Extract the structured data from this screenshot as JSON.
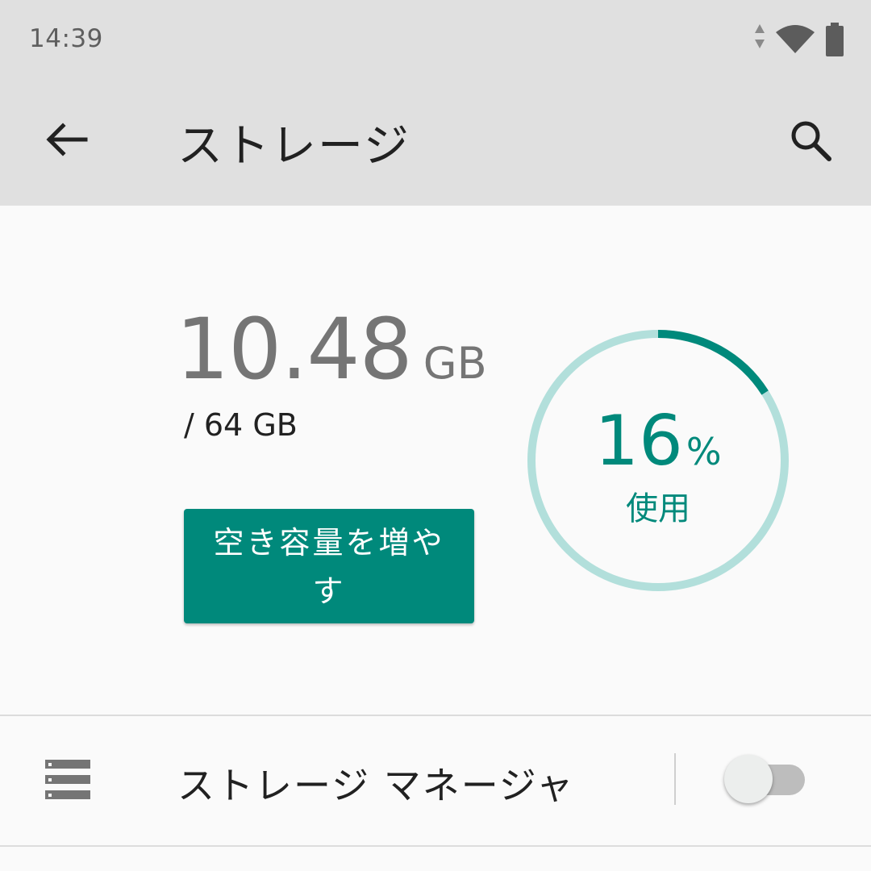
{
  "status_bar": {
    "time": "14:39",
    "icons": [
      "data-arrows-icon",
      "wifi-icon",
      "battery-icon"
    ]
  },
  "app_bar": {
    "title": "ストレージ",
    "back_icon": "arrow-back-icon",
    "search_icon": "search-icon"
  },
  "storage": {
    "used_value": "10.48",
    "used_unit": "GB",
    "total": "/ 64 GB",
    "free_up_button": "空き容量を増やす",
    "percent_value": "16",
    "percent_sign": "%",
    "percent_label": "使用",
    "used_fraction": 0.16
  },
  "storage_manager": {
    "icon": "storage-list-icon",
    "label": "ストレージ マネージャ",
    "toggle_on": false
  },
  "colors": {
    "accent": "#00897b",
    "ring_track": "#b2dfdb",
    "bar_background": "#e0e0e0",
    "page_background": "#fafafa"
  }
}
